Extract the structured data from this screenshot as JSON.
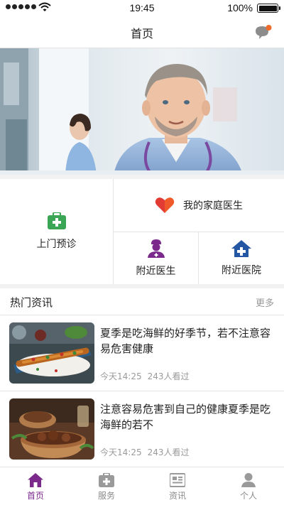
{
  "status_bar": {
    "time": "19:45",
    "battery": "100%"
  },
  "nav": {
    "title": "首页",
    "message_icon": "chat-bubble-icon"
  },
  "banner": {
    "image": "doctor-with-stethoscope"
  },
  "quick_actions": {
    "home_visit": {
      "label": "上门预诊",
      "icon": "medical-kit-icon"
    },
    "family_doctor": {
      "label": "我的家庭医生",
      "icon": "heart-icon"
    },
    "nearby_doctor": {
      "label": "附近医生",
      "icon": "nurse-icon"
    },
    "nearby_hospital": {
      "label": "附近医院",
      "icon": "hospital-icon"
    }
  },
  "news": {
    "title": "热门资讯",
    "more": "更多",
    "items": [
      {
        "title": "夏季是吃海鲜的好季节，若不注意容易危害健康",
        "time": "今天14:25",
        "views": "243人看过"
      },
      {
        "title": "注意容易危害到自己的健康夏季是吃海鲜的若不",
        "time": "今天14:25",
        "views": "243人看过"
      }
    ]
  },
  "tabs": [
    {
      "label": "首页",
      "icon": "home-icon",
      "active": true
    },
    {
      "label": "服务",
      "icon": "service-kit-icon",
      "active": false
    },
    {
      "label": "资讯",
      "icon": "newspaper-icon",
      "active": false
    },
    {
      "label": "个人",
      "icon": "person-icon",
      "active": false
    }
  ],
  "colors": {
    "accent": "#7b2a8c",
    "green": "#3aa655",
    "red": "#e13b34",
    "blue": "#2456a4"
  }
}
